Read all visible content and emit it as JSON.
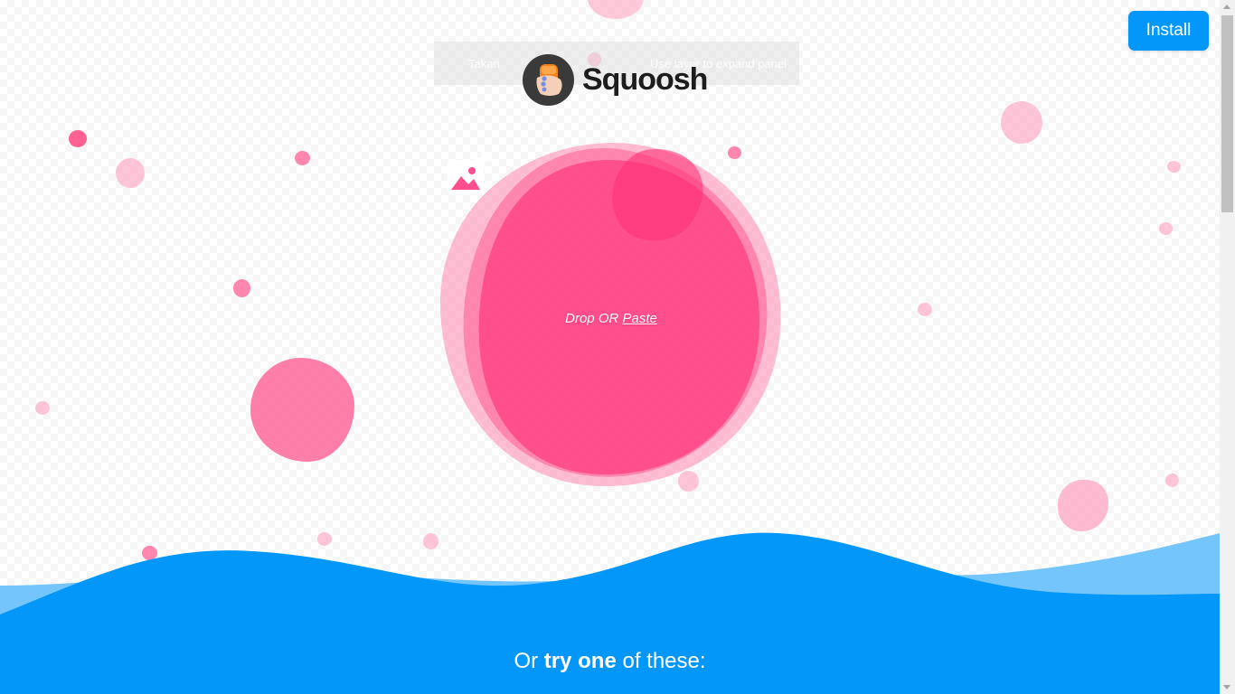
{
  "app": {
    "name": "Squoosh"
  },
  "header": {
    "install_label": "Install"
  },
  "ghost_toolbar": {
    "left_text": "Takan",
    "right_text": "Use layer to expand panel"
  },
  "drop_zone": {
    "icon": "add-image-icon",
    "drop_label": "Drop OR",
    "paste_label": "Paste"
  },
  "demo_section": {
    "heading_prefix": "Or",
    "heading_bold": "try one",
    "heading_suffix": "of these:"
  },
  "colors": {
    "accent_blue": "#0297f9",
    "wave_light_blue": "#73c5fb",
    "blob_pink": "#ff3d85",
    "background": "#ffffff"
  }
}
